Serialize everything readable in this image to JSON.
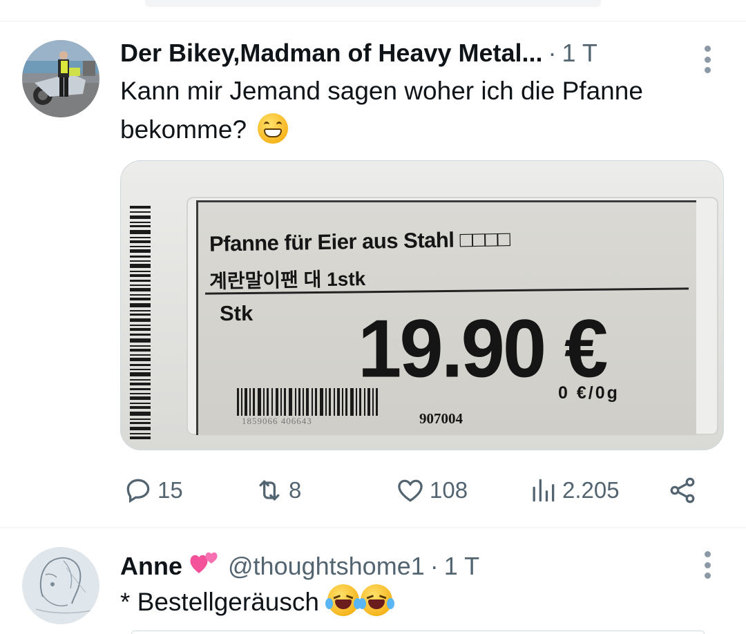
{
  "tweets": [
    {
      "name": "Der Bikey,Madman of Heavy Metal...",
      "separator": "·",
      "time": "1 T",
      "text": "Kann mir Jemand sagen woher ich die Pfanne bekomme?",
      "emoji": "grinning-face-emoji",
      "media": {
        "line1": "Pfanne für Eier aus Stahl □□□□",
        "line2": "계란말이팬 대 1stk",
        "unit_label": "Stk",
        "price": "19.90 €",
        "unit_price": "0 €/0g",
        "code": "907004",
        "barcode_digits": "1859066   406643"
      },
      "actions": {
        "replies": "15",
        "retweets": "8",
        "likes": "108",
        "views": "2.205"
      }
    },
    {
      "name": "Anne",
      "name_emoji": "two-hearts-emoji",
      "handle": "@thoughtshome1",
      "separator": "·",
      "time": "1 T",
      "text": "* Bestellgeräusch",
      "emoji": "tears-of-joy-emoji"
    }
  ],
  "colors": {
    "text": "#0f1419",
    "secondary": "#536471",
    "divider": "#eff3f4",
    "heart": "#e0245e"
  }
}
